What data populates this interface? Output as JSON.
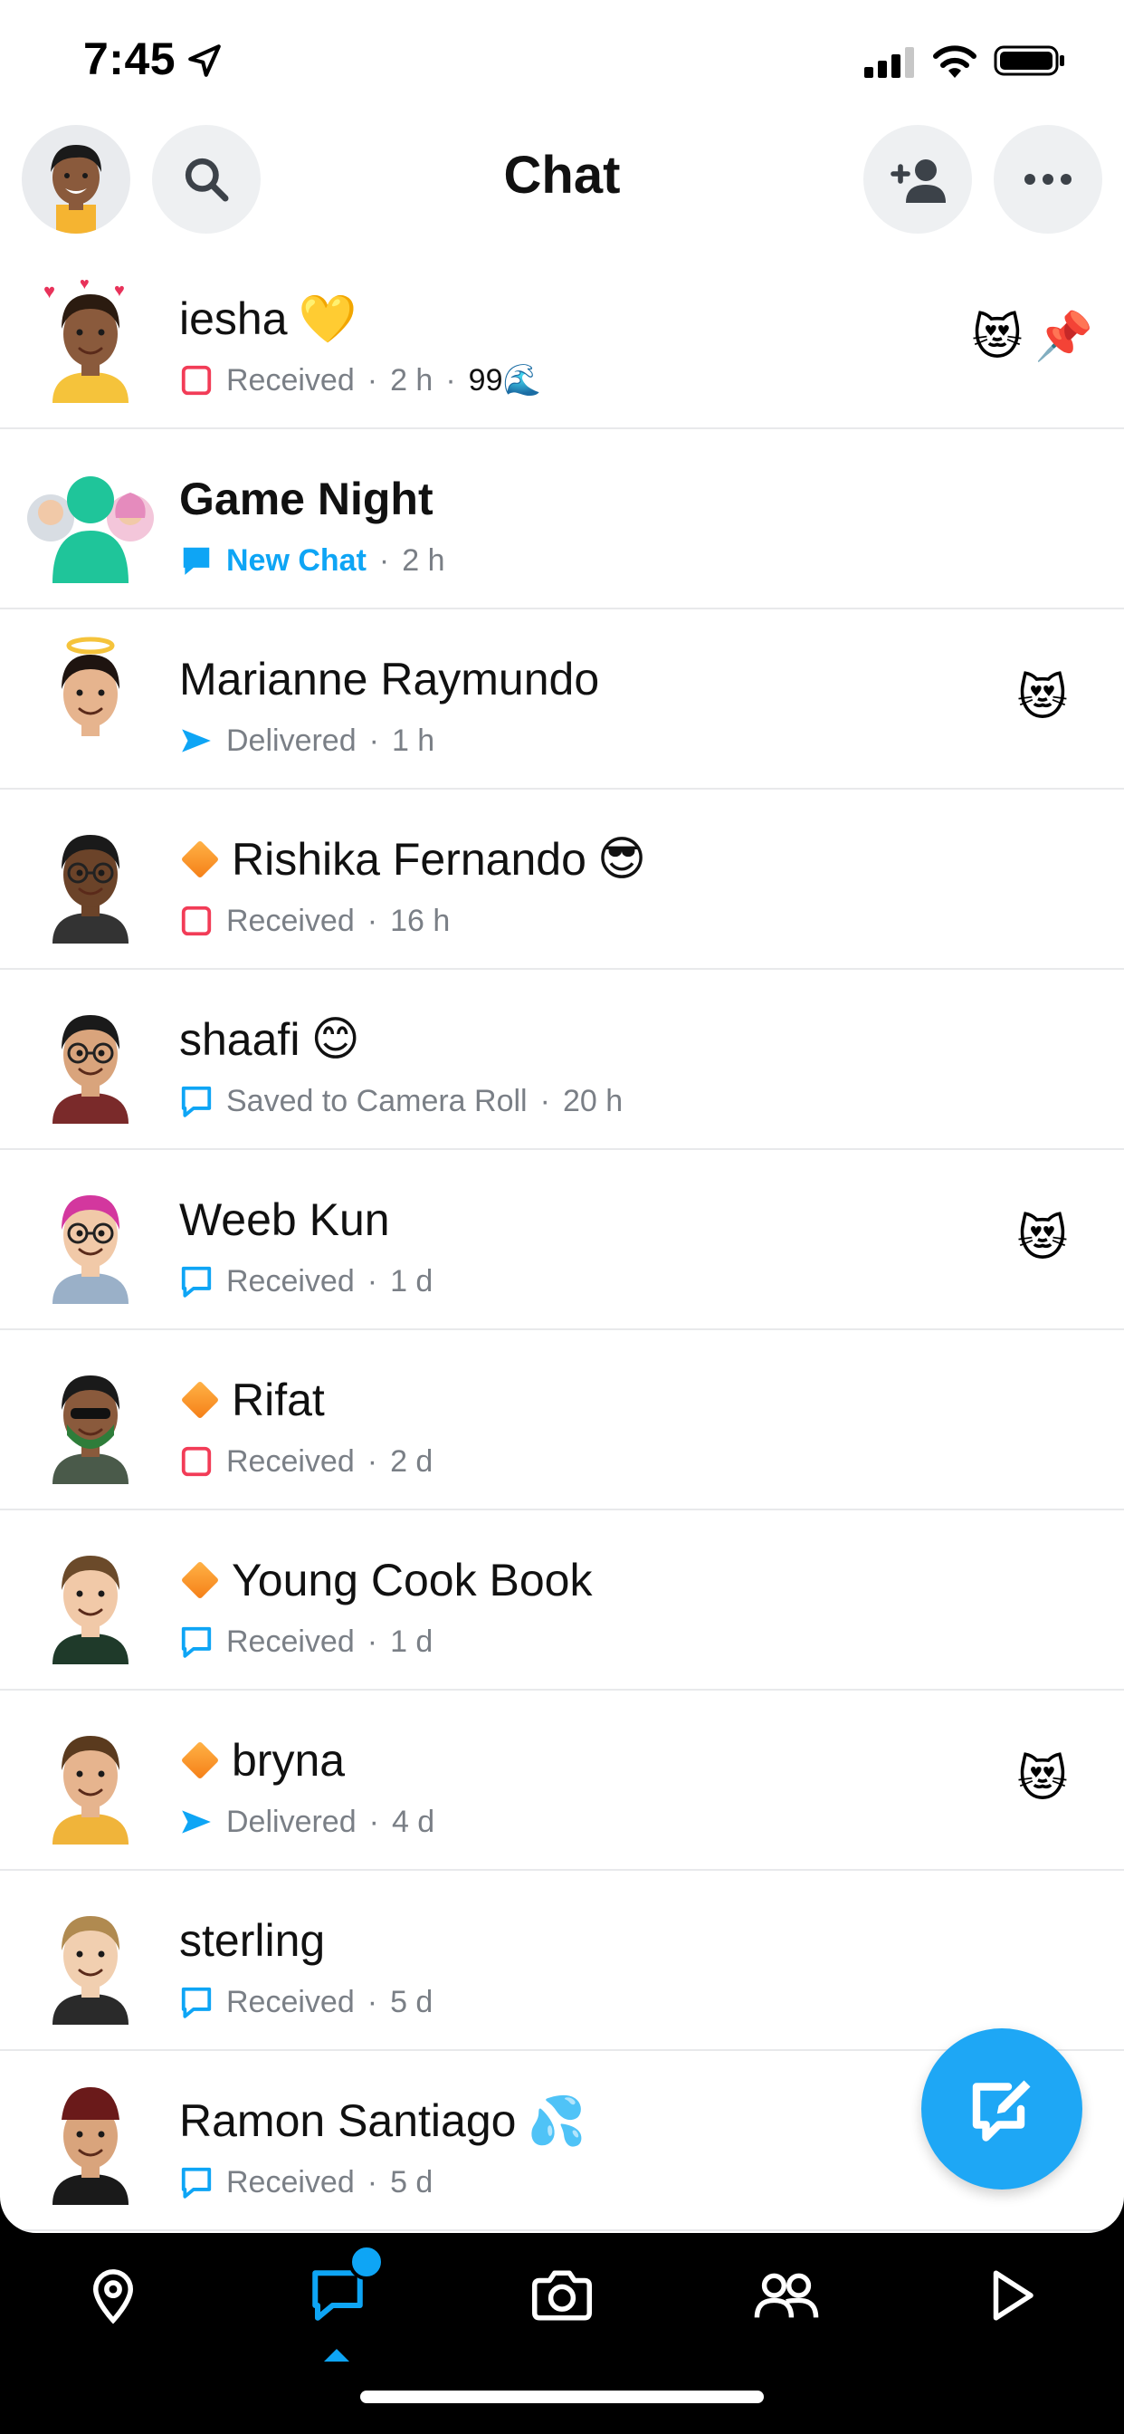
{
  "status_bar": {
    "time": "7:45"
  },
  "header": {
    "title": "Chat"
  },
  "chats": [
    {
      "name": "iesha",
      "name_emoji": "💛",
      "diamond": false,
      "bold": false,
      "status_icon": "received-snap-red",
      "status": "Received",
      "time": "2 h",
      "streak": "99🌊",
      "right_emoji": "😻",
      "pinned": true,
      "pin_icon": "📌",
      "avatar": {
        "skin": "#8a5a3c",
        "hair": "#2b1b10",
        "shirt": "#f5c33b",
        "accessory": "hearts"
      }
    },
    {
      "name": "Game Night",
      "name_emoji": "",
      "diamond": false,
      "bold": true,
      "status_icon": "new-chat-blue",
      "status": "New Chat",
      "status_blue": true,
      "time": "2 h",
      "streak": "",
      "right_emoji": "",
      "pinned": false,
      "avatar": {
        "group": true
      }
    },
    {
      "name": "Marianne Raymundo",
      "name_emoji": "",
      "diamond": false,
      "bold": false,
      "status_icon": "delivered-arrow-blue",
      "status": "Delivered",
      "time": "1 h",
      "streak": "",
      "right_emoji": "😻",
      "pinned": false,
      "avatar": {
        "skin": "#e6b48e",
        "hair": "#1e1410",
        "shirt": "#ffffff",
        "accessory": "halo"
      }
    },
    {
      "name": "Rishika Fernando",
      "name_emoji": "😎",
      "diamond": true,
      "bold": false,
      "status_icon": "received-snap-red",
      "status": "Received",
      "time": "16 h",
      "streak": "",
      "right_emoji": "",
      "pinned": false,
      "avatar": {
        "skin": "#6b4329",
        "hair": "#1a1a1a",
        "shirt": "#333333",
        "accessory": "glasses"
      }
    },
    {
      "name": "shaafi",
      "name_emoji": "😊",
      "diamond": false,
      "bold": false,
      "status_icon": "chat-bubble-blue",
      "status": "Saved to Camera Roll",
      "time": "20 h",
      "streak": "",
      "right_emoji": "",
      "pinned": false,
      "avatar": {
        "skin": "#d9a47c",
        "hair": "#1a1a1a",
        "shirt": "#7a2a2a",
        "accessory": "glasses"
      }
    },
    {
      "name": "Weeb Kun",
      "name_emoji": "",
      "diamond": false,
      "bold": false,
      "status_icon": "chat-bubble-blue",
      "status": "Received",
      "time": "1 d",
      "streak": "",
      "right_emoji": "😻",
      "pinned": false,
      "avatar": {
        "skin": "#f1c9a8",
        "hair": "#d3379e",
        "shirt": "#9ab0c8",
        "accessory": "glasses"
      }
    },
    {
      "name": "Rifat",
      "name_emoji": "",
      "diamond": true,
      "bold": false,
      "status_icon": "received-snap-red",
      "status": "Received",
      "time": "2 d",
      "streak": "",
      "right_emoji": "",
      "pinned": false,
      "avatar": {
        "skin": "#8a5a3c",
        "hair": "#1a1a1a",
        "shirt": "#4a5a4a",
        "accessory": "mask"
      }
    },
    {
      "name": "Young Cook Book",
      "name_emoji": "",
      "diamond": true,
      "bold": false,
      "status_icon": "chat-bubble-blue",
      "status": "Received",
      "time": "1 d",
      "streak": "",
      "right_emoji": "",
      "pinned": false,
      "avatar": {
        "skin": "#f1c9a8",
        "hair": "#6b4a2a",
        "shirt": "#1f3a2a",
        "accessory": "none"
      }
    },
    {
      "name": "bryna",
      "name_emoji": "",
      "diamond": true,
      "bold": false,
      "status_icon": "delivered-arrow-blue",
      "status": "Delivered",
      "time": "4 d",
      "streak": "",
      "right_emoji": "😻",
      "pinned": false,
      "avatar": {
        "skin": "#e6b48e",
        "hair": "#5a3a1e",
        "shirt": "#f0b43a",
        "accessory": "none"
      }
    },
    {
      "name": "sterling",
      "name_emoji": "",
      "diamond": false,
      "bold": false,
      "status_icon": "chat-bubble-blue",
      "status": "Received",
      "time": "5 d",
      "streak": "",
      "right_emoji": "",
      "pinned": false,
      "avatar": {
        "skin": "#f1cfb0",
        "hair": "#b08a50",
        "shirt": "#2a2a2a",
        "accessory": "none"
      }
    },
    {
      "name": "Ramon Santiago",
      "name_emoji": "💦",
      "diamond": false,
      "bold": false,
      "status_icon": "chat-bubble-blue",
      "status": "Received",
      "time": "5 d",
      "streak": "",
      "right_emoji": "",
      "pinned": false,
      "avatar": {
        "skin": "#d9a47c",
        "hair": "#6a1a1a",
        "shirt": "#1a1a1a",
        "accessory": "beanie"
      }
    }
  ],
  "colors": {
    "accent": "#0ea5f5",
    "received_red": "#f23c57",
    "fab": "#1ea7f5",
    "diamond": "#f57f17"
  },
  "nav": {
    "items": [
      "map-icon",
      "chat-icon",
      "camera-icon",
      "friends-icon",
      "stories-icon"
    ],
    "active": "chat-icon",
    "chat_badge": true
  }
}
